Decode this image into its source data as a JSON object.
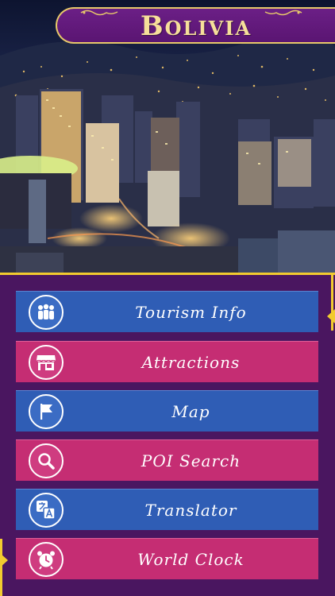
{
  "header": {
    "title": "Bolivia"
  },
  "hero": {
    "image": "night-cityscape-photo"
  },
  "menu": {
    "items": [
      {
        "label": "Tourism Info",
        "icon": "tourists-group-icon",
        "color": "#2f5db5"
      },
      {
        "label": "Attractions",
        "icon": "storefront-icon",
        "color": "#c52d73"
      },
      {
        "label": "Map",
        "icon": "flag-icon",
        "color": "#2f5db5"
      },
      {
        "label": "POI Search",
        "icon": "magnifier-icon",
        "color": "#c52d73"
      },
      {
        "label": "Translator",
        "icon": "translate-icon",
        "color": "#2f5db5"
      },
      {
        "label": "World Clock",
        "icon": "alarm-clock-icon",
        "color": "#c52d73"
      }
    ]
  },
  "colors": {
    "panel": "#4a1660",
    "gold": "#f2cb2f",
    "banner": "#6b1f86",
    "banner_text": "#f6df9a"
  }
}
